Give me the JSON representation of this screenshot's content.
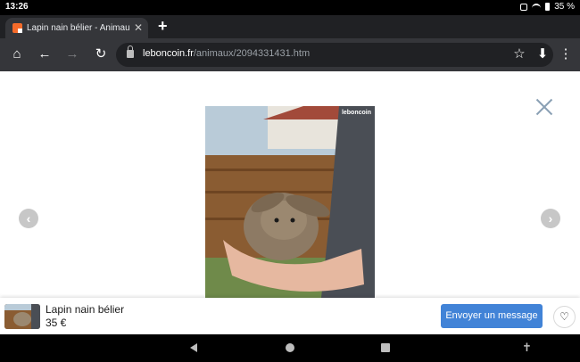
{
  "status_bar": {
    "time": "13:26",
    "battery": "35 %"
  },
  "browser": {
    "tab_title": "Lapin nain bélier - Animaux",
    "tab_close": "✕",
    "new_tab": "+",
    "url_host": "leboncoin.fr",
    "url_path": "/animaux/2094331431.htm"
  },
  "toolbar": {
    "home_icon": "⌂",
    "back_icon": "←",
    "forward_icon": "→",
    "reload_icon": "↻",
    "star_icon": "☆",
    "download_icon": "⬇",
    "menu_icon": "⋮"
  },
  "gallery": {
    "watermark": "leboncoin",
    "prev_icon": "‹",
    "next_icon": "›"
  },
  "ad": {
    "title": "Lapin nain bélier",
    "price": "35 €",
    "message_button": "Envoyer un message",
    "favorite_icon": "♡"
  },
  "android_nav": {
    "accessibility_icon": "✝"
  }
}
